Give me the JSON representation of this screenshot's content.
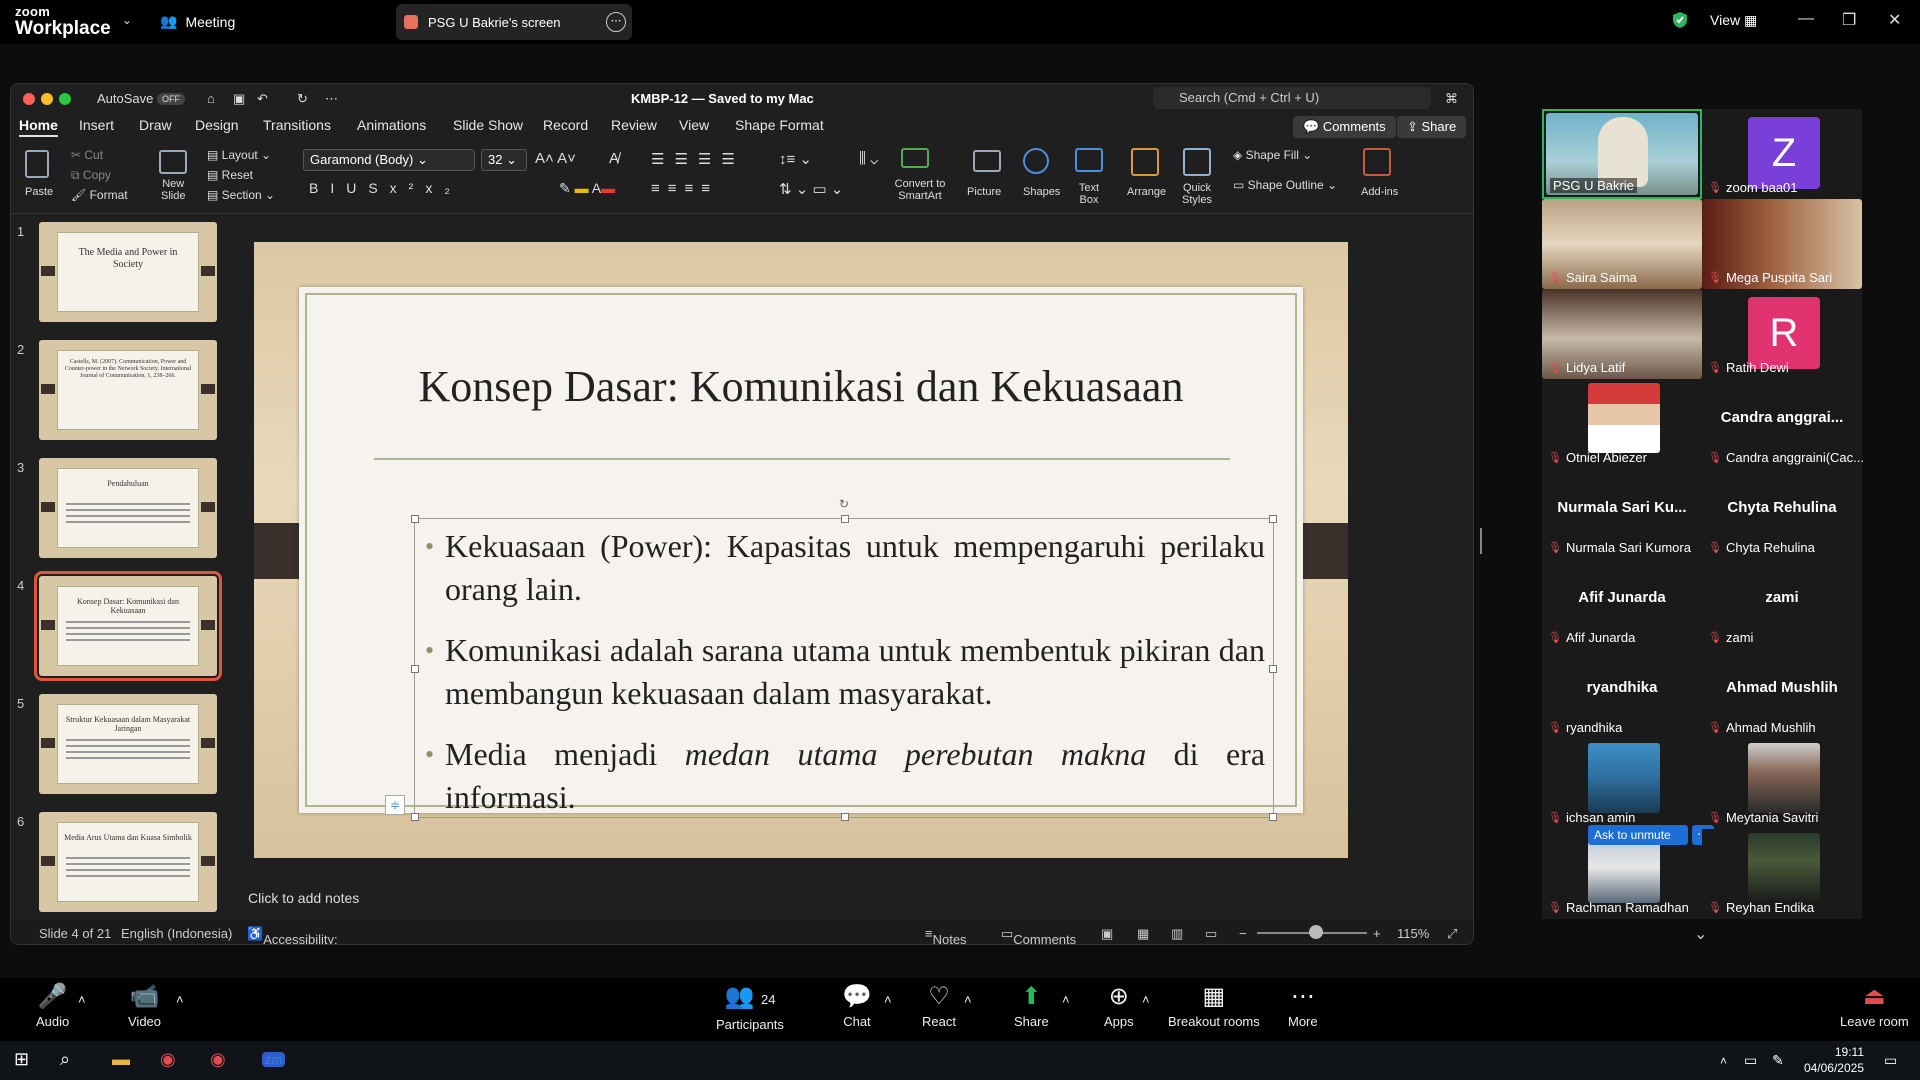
{
  "zoom": {
    "logo_top": "zoom",
    "logo_bottom": "Workplace",
    "meeting_label": "Meeting",
    "share_label": "PSG U Bakrie's screen",
    "view_label": "View",
    "toolbar": {
      "audio": "Audio",
      "video": "Video",
      "participants": "Participants",
      "participants_count": "24",
      "chat": "Chat",
      "react": "React",
      "share": "Share",
      "apps": "Apps",
      "breakout": "Breakout rooms",
      "more": "More",
      "leave": "Leave room"
    },
    "ask_to_unmute": "Ask to unmute",
    "participants": [
      {
        "name": "PSG U Bakrie",
        "kind": "video"
      },
      {
        "name": "zoom baa01",
        "kind": "avatar",
        "initial": "Z",
        "color": "#7b3fd9"
      },
      {
        "name": "Saira Saima",
        "kind": "video"
      },
      {
        "name": "Mega Puspita Sari",
        "kind": "video"
      },
      {
        "name": "Lidya Latif",
        "kind": "video"
      },
      {
        "name": "Ratih Dewi",
        "kind": "avatar",
        "initial": "R",
        "color": "#e0336f"
      },
      {
        "name": "Otniel Abiezer",
        "kind": "video"
      },
      {
        "name": "Candra anggraini(Cac...",
        "kind": "name",
        "big": "Candra anggrai..."
      },
      {
        "name": "Nurmala Sari Kumora",
        "kind": "name",
        "big": "Nurmala Sari Ku..."
      },
      {
        "name": "Chyta Rehulina",
        "kind": "name",
        "big": "Chyta Rehulina"
      },
      {
        "name": "Afif Junarda",
        "kind": "name",
        "big": "Afif Junarda"
      },
      {
        "name": "zami",
        "kind": "name",
        "big": "zami"
      },
      {
        "name": "ryandhika",
        "kind": "name",
        "big": "ryandhika"
      },
      {
        "name": "Ahmad Mushlih",
        "kind": "name",
        "big": "Ahmad Mushlih"
      },
      {
        "name": "ichsan amin",
        "kind": "video"
      },
      {
        "name": "Meytania Savitri",
        "kind": "video"
      },
      {
        "name": "Rachman Ramadhan",
        "kind": "video"
      },
      {
        "name": "Reyhan Endika",
        "kind": "video"
      }
    ]
  },
  "ppt": {
    "autosave": "AutoSave",
    "autosave_state": "OFF",
    "title": "KMBP-12 — Saved to my Mac",
    "search_placeholder": "Search (Cmd + Ctrl + U)",
    "tabs": [
      "Home",
      "Insert",
      "Draw",
      "Design",
      "Transitions",
      "Animations",
      "Slide Show",
      "Record",
      "Review",
      "View",
      "Shape Format"
    ],
    "comments_btn": "Comments",
    "share_btn": "Share",
    "ribbon": {
      "paste": "Paste",
      "cut": "Cut",
      "copy": "Copy",
      "format": "Format",
      "new_slide": "New\nSlide",
      "layout": "Layout",
      "reset": "Reset",
      "section": "Section",
      "font": "Garamond (Body)",
      "size": "32",
      "convert": "Convert to SmartArt",
      "picture": "Picture",
      "shapes": "Shapes",
      "textbox": "Text Box",
      "arrange": "Arrange",
      "quick_styles": "Quick Styles",
      "shape_fill": "Shape Fill",
      "shape_outline": "Shape Outline",
      "addins": "Add-ins"
    },
    "thumbs": [
      {
        "n": "1",
        "title": "The Media and Power in Society"
      },
      {
        "n": "2",
        "title": "Castells, M. (2007). Communication, Power and Counter-power in the Network Society. International Journal of Communication, 1, 238–266."
      },
      {
        "n": "3",
        "title": "Pendahuluan"
      },
      {
        "n": "4",
        "title": "Konsep Dasar: Komunikasi dan Kekuasaan"
      },
      {
        "n": "5",
        "title": "Struktur Kekuasaan dalam Masyarakat Jaringan"
      },
      {
        "n": "6",
        "title": "Media Arus Utama dan Kuasa Simbolik"
      }
    ],
    "slide": {
      "title": "Konsep Dasar: Komunikasi dan Kekuasaan",
      "b1": "Kekuasaan (Power): Kapasitas untuk mempengaruhi perilaku orang lain.",
      "b2": "Komunikasi adalah sarana utama untuk membentuk pikiran dan membangun kekuasaan dalam masyarakat.",
      "b3_pre": "Media menjadi ",
      "b3_em": "medan utama perebutan makna",
      "b3_post": " di era informasi."
    },
    "notes": "Click to add notes",
    "status": {
      "slide": "Slide 4 of 21",
      "lang": "English (Indonesia)",
      "access": "Accessibility: Investigate",
      "notes": "Notes",
      "comments": "Comments",
      "zoom": "115%"
    }
  },
  "taskbar": {
    "time": "19:11",
    "date": "04/06/2025"
  }
}
